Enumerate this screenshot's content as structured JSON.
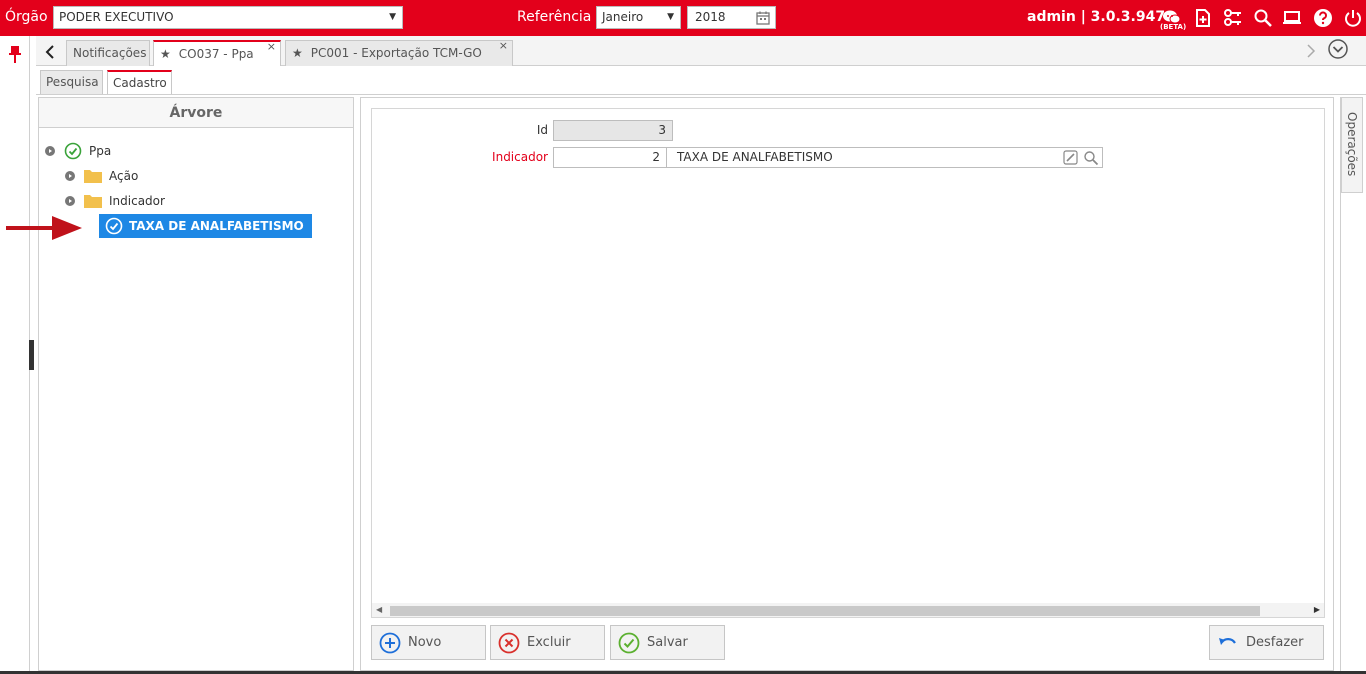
{
  "topbar": {
    "orgao_label": "Órgão",
    "orgao_value": "PODER EXECUTIVO",
    "referencia_label": "Referência",
    "month_value": "Janeiro",
    "year_value": "2018",
    "user_version": "admin | 3.0.3.947",
    "beta_label": "(BETA)",
    "bg_color": "#e3001b"
  },
  "tabs": [
    {
      "label": "Notificações"
    },
    {
      "label": "CO037 - Ppa"
    },
    {
      "label": "PC001 - Exportação TCM-GO"
    }
  ],
  "subtabs": [
    {
      "label": "Pesquisa"
    },
    {
      "label": "Cadastro"
    }
  ],
  "tree": {
    "title": "Árvore",
    "root": "Ppa",
    "children": [
      "Ação",
      "Indicador"
    ],
    "selected": "TAXA DE ANALFABETISMO"
  },
  "form": {
    "id_label": "Id",
    "id_value": "3",
    "indicador_label": "Indicador",
    "indicador_code": "2",
    "indicador_desc": "TAXA DE ANALFABETISMO"
  },
  "buttons": {
    "novo": "Novo",
    "excluir": "Excluir",
    "salvar": "Salvar",
    "desfazer": "Desfazer"
  },
  "side": {
    "operacoes": "Operações"
  }
}
